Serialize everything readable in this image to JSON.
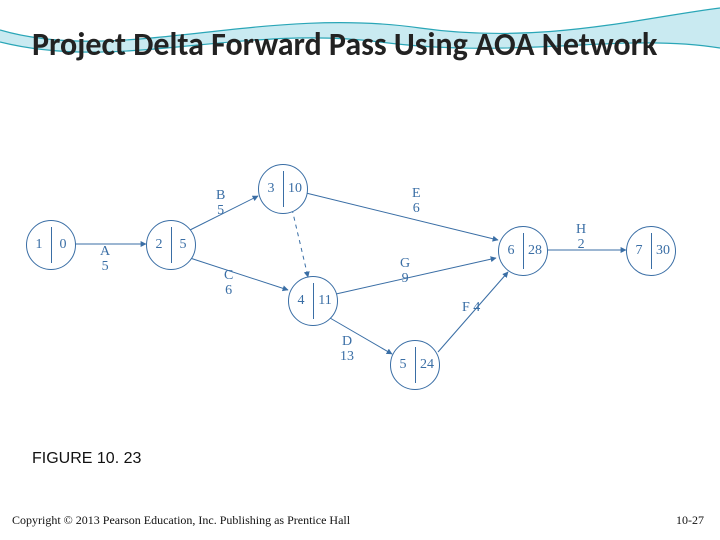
{
  "title": "Project Delta Forward Pass Using AOA Network",
  "figure_caption": "FIGURE 10. 23",
  "copyright": "Copyright © 2013 Pearson Education, Inc. Publishing as Prentice Hall",
  "slide_number": "10-27",
  "chart_data": {
    "type": "diagram",
    "diagram_type": "activity-on-arrow network",
    "nodes": [
      {
        "id": 1,
        "value": 0
      },
      {
        "id": 2,
        "value": 5
      },
      {
        "id": 3,
        "value": 10
      },
      {
        "id": 4,
        "value": 11
      },
      {
        "id": 5,
        "value": 24
      },
      {
        "id": 6,
        "value": 28
      },
      {
        "id": 7,
        "value": 30
      }
    ],
    "activities": [
      {
        "name": "A",
        "duration": 5,
        "from": 1,
        "to": 2
      },
      {
        "name": "B",
        "duration": 5,
        "from": 2,
        "to": 3
      },
      {
        "name": "C",
        "duration": 6,
        "from": 2,
        "to": 4
      },
      {
        "name": "D",
        "duration": 13,
        "from": 4,
        "to": 5
      },
      {
        "name": "E",
        "duration": 6,
        "from": 3,
        "to": 6
      },
      {
        "name": "F",
        "duration": 4,
        "from": 5,
        "to": 6
      },
      {
        "name": "G",
        "duration": 9,
        "from": 4,
        "to": 6
      },
      {
        "name": "H",
        "duration": 2,
        "from": 6,
        "to": 7
      }
    ],
    "dummy_arcs": [
      {
        "from": 3,
        "to": 4
      }
    ],
    "title": "Project Delta Forward Pass Using AOA Network"
  },
  "nodes": {
    "n1": {
      "id": "1",
      "val": "0"
    },
    "n2": {
      "id": "2",
      "val": "5"
    },
    "n3": {
      "id": "3",
      "val": "10"
    },
    "n4": {
      "id": "4",
      "val": "11"
    },
    "n5": {
      "id": "5",
      "val": "24"
    },
    "n6": {
      "id": "6",
      "val": "28"
    },
    "n7": {
      "id": "7",
      "val": "30"
    }
  },
  "acts": {
    "A": {
      "name": "A",
      "dur": "5"
    },
    "B": {
      "name": "B",
      "dur": "5"
    },
    "C": {
      "name": "C",
      "dur": "6"
    },
    "D": {
      "name": "D",
      "dur": "13"
    },
    "E": {
      "name": "E",
      "dur": "6"
    },
    "F": {
      "name": "F",
      "dur": "4"
    },
    "G": {
      "name": "G",
      "dur": "9"
    },
    "H": {
      "name": "H",
      "dur": "2"
    }
  }
}
